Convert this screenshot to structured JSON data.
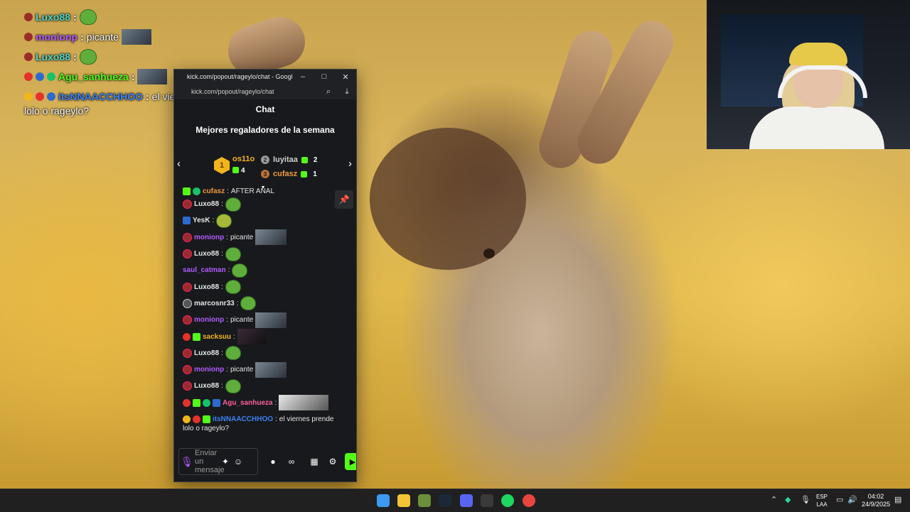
{
  "overlay_chat": [
    {
      "user": "Luxo88",
      "color": "#53d3c4",
      "message": "",
      "emote": "pepe"
    },
    {
      "user": "monionp",
      "color": "#b25cff",
      "message": "picante",
      "emote": "thumb"
    },
    {
      "user": "Luxo88",
      "color": "#53d3c4",
      "message": "",
      "emote": "pepe"
    },
    {
      "user": "Agu_sanhueza",
      "color": "#53fc18",
      "message": "",
      "emote": "thumb"
    },
    {
      "user": "itsNNAACCHHOO",
      "color": "#3b82f6",
      "message": "el viernes prende",
      "emote": ""
    }
  ],
  "overlay_wrap": "lolo o rageylo?",
  "window": {
    "title": "kick.com/popout/rageylo/chat - Google...",
    "url": "kick.com/popout/rageylo/chat",
    "minimize": "–",
    "maximize": "□",
    "close": "✕"
  },
  "chat": {
    "header": "Chat",
    "gifters_title": "Mejores regaladores de la semana",
    "top1": {
      "rank": "1",
      "name": "os11o",
      "count": "4"
    },
    "top2": {
      "rank": "2",
      "name": "luyitaa",
      "count": "2"
    },
    "top3": {
      "rank": "3",
      "name": "cufasz",
      "count": "1"
    },
    "first_partial": {
      "user": "cufasz",
      "message": "AFTER ANAL"
    },
    "messages": [
      {
        "user": "Luxo88",
        "color": "#e6e6e6",
        "text": ""
      },
      {
        "user": "YesK",
        "color": "#e6e6e6",
        "text": ""
      },
      {
        "user": "monionp",
        "color": "#b25cff",
        "text": "picante"
      },
      {
        "user": "Luxo88",
        "color": "#e6e6e6",
        "text": ""
      },
      {
        "user": "saul_catman",
        "color": "#b25cff",
        "text": ""
      },
      {
        "user": "Luxo88",
        "color": "#e6e6e6",
        "text": ""
      },
      {
        "user": "marcosnr33",
        "color": "#e6e6e6",
        "text": ""
      },
      {
        "user": "monionp",
        "color": "#b25cff",
        "text": "picante"
      },
      {
        "user": "sacksuu",
        "color": "#f2b51c",
        "text": ""
      },
      {
        "user": "Luxo88",
        "color": "#e6e6e6",
        "text": ""
      },
      {
        "user": "monionp",
        "color": "#b25cff",
        "text": "picante"
      },
      {
        "user": "Luxo88",
        "color": "#e6e6e6",
        "text": ""
      },
      {
        "user": "Agu_sanhueza",
        "color": "#ff5ea0",
        "text": ""
      },
      {
        "user": "itsNNAACCHHOO",
        "color": "#3b82f6",
        "text": "el viernes prende"
      }
    ],
    "last_wrap": "lolo o rageylo?",
    "input_placeholder": "Enviar un mensaje"
  },
  "taskbar": {
    "lang_top": "ESP",
    "lang_bottom": "LAA",
    "time": "04:02",
    "date": "24/9/2025"
  },
  "colors": {
    "kick_green": "#53fc18",
    "chat_bg": "#18191c"
  }
}
